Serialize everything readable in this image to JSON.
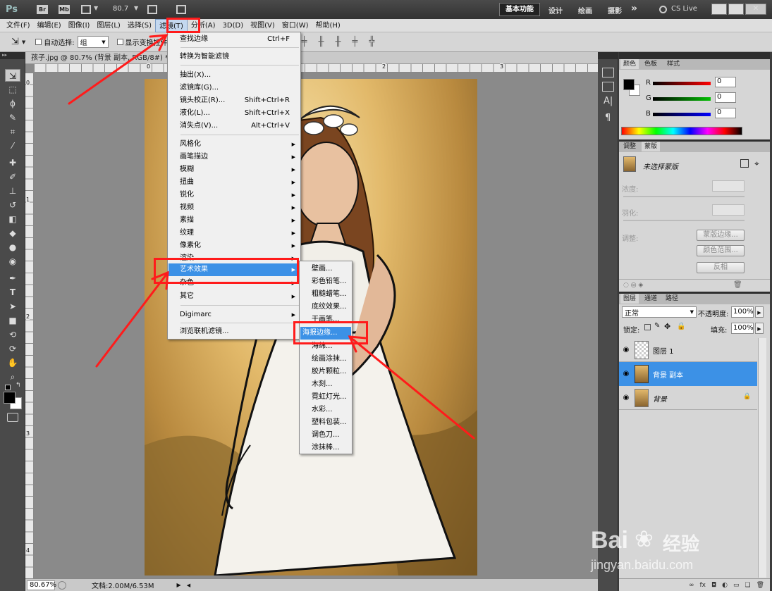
{
  "appbar": {
    "logo": "Ps",
    "btn_br": "Br",
    "btn_mb": "Mb",
    "zoom": "80.7",
    "ws_basic": "基本功能",
    "ws_design": "设计",
    "ws_paint": "绘画",
    "ws_photo": "摄影",
    "more": "»",
    "cslive": "CS Live"
  },
  "menubar": {
    "items": [
      "文件(F)",
      "编辑(E)",
      "图像(I)",
      "图层(L)",
      "选择(S)",
      "滤镜(T)",
      "分析(A)",
      "3D(D)",
      "视图(V)",
      "窗口(W)",
      "帮助(H)"
    ]
  },
  "options": {
    "auto_select": "自动选择:",
    "auto_select_value": "组",
    "show_transform": "显示变换控件"
  },
  "document": {
    "tab_title": "孩子.jpg @ 80.7% (背景 副本, RGB/8#) *",
    "ruler_h": [
      "0",
      "1",
      "2",
      "3"
    ],
    "ruler_v": [
      "0",
      "1",
      "2",
      "3",
      "4"
    ],
    "zoom_status": "80.67%",
    "doc_status": "文档:2.00M/6.53M"
  },
  "filter_menu": {
    "top": [
      {
        "label": "查找边缘",
        "shortcut": "Ctrl+F"
      },
      {
        "label": "转换为智能滤镜",
        "shortcut": ""
      },
      {
        "label": "抽出(X)...",
        "shortcut": ""
      },
      {
        "label": "滤镜库(G)...",
        "shortcut": ""
      },
      {
        "label": "镜头校正(R)...",
        "shortcut": "Shift+Ctrl+R"
      },
      {
        "label": "液化(L)...",
        "shortcut": "Shift+Ctrl+X"
      },
      {
        "label": "消失点(V)...",
        "shortcut": "Alt+Ctrl+V"
      }
    ],
    "sub": [
      "风格化",
      "画笔描边",
      "模糊",
      "扭曲",
      "锐化",
      "视频",
      "素描",
      "纹理",
      "像素化",
      "渲染",
      "艺术效果",
      "杂色",
      "其它"
    ],
    "digimarc": "Digimarc",
    "browse": "浏览联机滤镜..."
  },
  "artistic_menu": {
    "items": [
      "壁画...",
      "彩色铅笔...",
      "粗糙蜡笔...",
      "底纹效果...",
      "干画笔...",
      "海报边缘...",
      "海绵...",
      "绘画涂抹...",
      "胶片颗粒...",
      "木刻...",
      "霓虹灯光...",
      "水彩...",
      "塑料包装...",
      "调色刀...",
      "涂抹棒..."
    ],
    "selected_index": 5
  },
  "color_panel": {
    "tabs": [
      "颜色",
      "色板",
      "样式"
    ],
    "r_label": "R",
    "g_label": "G",
    "b_label": "B",
    "r": "0",
    "g": "0",
    "b": "0"
  },
  "adjust_panel": {
    "tabs": [
      "调整",
      "蒙版"
    ],
    "no_mask": "未选择蒙版",
    "density": "浓度:",
    "feather": "羽化:",
    "refine": "调整:",
    "btn_edge": "蒙版边缘...",
    "btn_range": "颜色范围...",
    "btn_invert": "反相"
  },
  "layers_panel": {
    "tabs": [
      "图层",
      "通道",
      "路径"
    ],
    "blend": "正常",
    "opacity_label": "不透明度:",
    "opacity": "100%",
    "lock_label": "锁定:",
    "fill_label": "填充:",
    "fill": "100%",
    "layers": [
      {
        "name": "图层 1",
        "selected": false
      },
      {
        "name": "背景 副本",
        "selected": true
      },
      {
        "name": "背景",
        "selected": false
      }
    ]
  },
  "watermark": {
    "logo": "Bai",
    "text": "经验",
    "url": "jingyan.baidu.com"
  },
  "colors": {
    "highlight": "#3c91e6",
    "annotation": "#ff1b1b"
  }
}
